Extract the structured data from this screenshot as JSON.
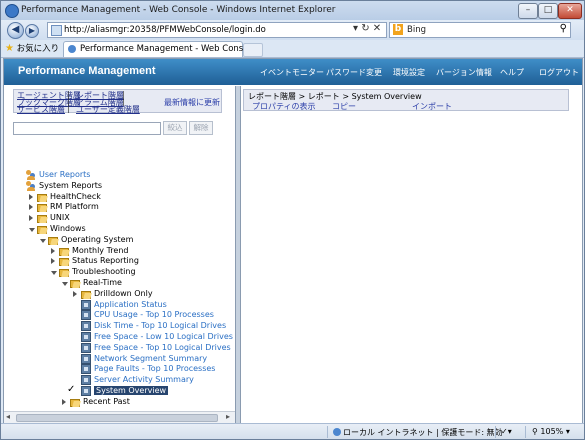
{
  "window": {
    "title": "Performance Management - Web Console - Windows Internet Explorer",
    "min": "–",
    "max": "□",
    "close": "✕"
  },
  "browser": {
    "back_icon": "back-arrow-icon",
    "forward_icon": "forward-arrow-icon",
    "address": "http://aliasmgr:20358/PFMWebConsole/login.do",
    "search_value": "Bing",
    "favorites_label": "お気に入り",
    "tab_title": "Performance Management - Web Console"
  },
  "app": {
    "brand": "Performance Management",
    "menu": [
      "イベントモニター",
      "パスワード変更",
      "環境設定",
      "バージョン情報",
      "ヘルプ",
      "ログアウト"
    ]
  },
  "left": {
    "links_row1": [
      "エージェント階層",
      "レポート階層"
    ],
    "links_row2": [
      "ブックマーク階層",
      "アラーム階層"
    ],
    "links_row3": [
      "サービス階層",
      "ユーザー定義階層"
    ],
    "refresh": "最新情報に更新",
    "filter_btn": "絞込",
    "clear_btn": "解除",
    "tree": [
      {
        "label": "User Reports",
        "level": 0,
        "icon": "users",
        "tri": "none",
        "blue": true
      },
      {
        "label": "System Reports",
        "level": 0,
        "icon": "users",
        "tri": "none",
        "blue": false
      },
      {
        "label": "HealthCheck",
        "level": 1,
        "icon": "folder",
        "tri": "closed"
      },
      {
        "label": "RM Platform",
        "level": 1,
        "icon": "folder",
        "tri": "closed"
      },
      {
        "label": "UNIX",
        "level": 1,
        "icon": "folder",
        "tri": "closed"
      },
      {
        "label": "Windows",
        "level": 1,
        "icon": "folder",
        "tri": "open"
      },
      {
        "label": "Operating System",
        "level": 2,
        "icon": "folder",
        "tri": "open"
      },
      {
        "label": "Monthly Trend",
        "level": 3,
        "icon": "folder",
        "tri": "closed"
      },
      {
        "label": "Status Reporting",
        "level": 3,
        "icon": "folder",
        "tri": "closed"
      },
      {
        "label": "Troubleshooting",
        "level": 3,
        "icon": "folder",
        "tri": "open"
      },
      {
        "label": "Real-Time",
        "level": 4,
        "icon": "folder",
        "tri": "open"
      },
      {
        "label": "Drilldown Only",
        "level": 5,
        "icon": "folder",
        "tri": "closed"
      },
      {
        "label": "Application Status",
        "level": 5,
        "icon": "report",
        "tri": "none",
        "blue": true
      },
      {
        "label": "CPU Usage - Top 10 Processes",
        "level": 5,
        "icon": "report",
        "tri": "none",
        "blue": true
      },
      {
        "label": "Disk Time - Top 10 Logical Drives",
        "level": 5,
        "icon": "report",
        "tri": "none",
        "blue": true
      },
      {
        "label": "Free Space - Low 10 Logical Drives",
        "level": 5,
        "icon": "report",
        "tri": "none",
        "blue": true
      },
      {
        "label": "Free Space - Top 10 Logical Drives",
        "level": 5,
        "icon": "report",
        "tri": "none",
        "blue": true
      },
      {
        "label": "Network Segment Summary",
        "level": 5,
        "icon": "report",
        "tri": "none",
        "blue": true
      },
      {
        "label": "Page Faults - Top 10 Processes",
        "level": 5,
        "icon": "report",
        "tri": "none",
        "blue": true
      },
      {
        "label": "Server Activity Summary",
        "level": 5,
        "icon": "report",
        "tri": "none",
        "blue": true
      },
      {
        "label": "System Overview",
        "level": 5,
        "icon": "report",
        "tri": "none",
        "selected": true,
        "checked": true
      },
      {
        "label": "Recent Past",
        "level": 4,
        "icon": "folder",
        "tri": "closed"
      }
    ]
  },
  "right": {
    "breadcrumb": "レポート階層 > レポート > System Overview",
    "actions": [
      "プロパティの表示",
      "コピー",
      "インポート"
    ]
  },
  "status": {
    "zone": "ローカル イントラネット | 保護モード: 無効",
    "zoom": "105%"
  }
}
